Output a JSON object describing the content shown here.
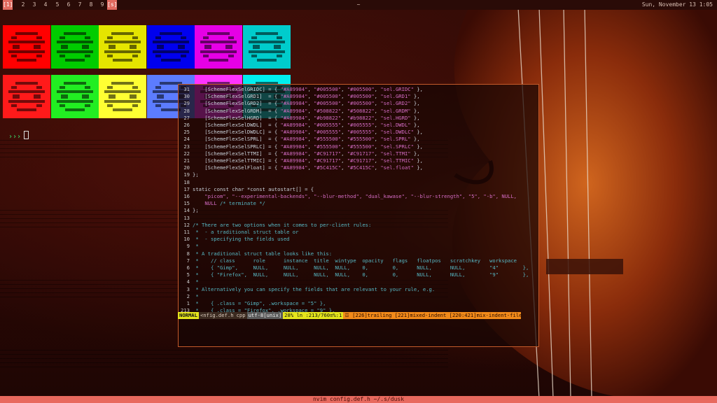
{
  "topbar": {
    "tags": [
      "[1]",
      "2",
      "3",
      "4",
      "5",
      "6",
      "7",
      "8",
      "9",
      "[s]"
    ],
    "active_tag": 0,
    "window_title": "~",
    "clock": "Sun, November 13 1:05"
  },
  "palette": {
    "row1": [
      "#ff0000",
      "#00cc00",
      "#e5e500",
      "#0000ee",
      "#e600e6",
      "#00cccc"
    ],
    "row2": [
      "#ff1a1a",
      "#22ee22",
      "#ffff33",
      "#5c7cff",
      "#ff33ff",
      "#00eeee"
    ],
    "icon": "space-invader-icon"
  },
  "terminal": {
    "prompt_symbol": "›››",
    "cursor": ""
  },
  "editor": {
    "lines": [
      {
        "num": "31",
        "text": "    [SchemeFlexSelGRIDC] = { \"#A89984\", \"#005500\", \"#005500\", \"sel.GRIDC\" },",
        "cls": "mix"
      },
      {
        "num": "30",
        "text": "    [SchemeFlexSelGRD1]  = { \"#A89984\", \"#005500\", \"#005500\", \"sel.GRD1\" },",
        "cls": "mix"
      },
      {
        "num": "29",
        "text": "    [SchemeFlexSelGRD2]  = { \"#A89984\", \"#005500\", \"#005500\", \"sel.GRD2\" },",
        "cls": "mix"
      },
      {
        "num": "28",
        "text": "    [SchemeFlexSelGRDM]  = { \"#A89984\", \"#508822\", \"#508822\", \"sel.GRDM\" },",
        "cls": "mix"
      },
      {
        "num": "27",
        "text": "    [SchemeFlexSelHGRD]  = { \"#A89984\", \"#b98822\", \"#b98822\", \"sel.HGRD\" },",
        "cls": "mix"
      },
      {
        "num": "26",
        "text": "    [SchemeFlexSelDWDL]  = { \"#A89984\", \"#005555\", \"#005555\", \"sel.DWDL\" },",
        "cls": "mix"
      },
      {
        "num": "25",
        "text": "    [SchemeFlexSelDWDLC] = { \"#A89984\", \"#005555\", \"#005555\", \"sel.DWDLC\" },",
        "cls": "mix"
      },
      {
        "num": "24",
        "text": "    [SchemeFlexSelSPRL]  = { \"#A89984\", \"#555500\", \"#555500\", \"sel.SPRL\" },",
        "cls": "mix"
      },
      {
        "num": "23",
        "text": "    [SchemeFlexSelSPRLC] = { \"#A89984\", \"#555500\", \"#555500\", \"sel.SPRLC\" },",
        "cls": "mix"
      },
      {
        "num": "22",
        "text": "    [SchemeFlexSelTTMI]  = { \"#A89984\", \"#C91717\", \"#C91717\", \"sel.TTMI\" },",
        "cls": "mix"
      },
      {
        "num": "21",
        "text": "    [SchemeFlexSelTTMIC] = { \"#A89984\", \"#C91717\", \"#C91717\", \"sel.TTMIC\" },",
        "cls": "mix"
      },
      {
        "num": "20",
        "text": "    [SchemeFlexSelFloat] = { \"#A89984\", \"#5C415C\", \"#5C415C\", \"sel.float\" },",
        "cls": "mix"
      },
      {
        "num": "19",
        "text": "};",
        "cls": "plain"
      },
      {
        "num": "18",
        "text": "",
        "cls": "plain"
      },
      {
        "num": "17",
        "text": "static const char *const autostart[] = {",
        "cls": "plain"
      },
      {
        "num": "16",
        "text": "    \"picom\", \"--experimental-backends\", \"--blur-method\", \"dual_kawase\", \"--blur-strength\", \"5\", \"-b\", NULL,",
        "cls": "str"
      },
      {
        "num": "15",
        "text": "    NULL /* terminate */",
        "cls": "mix2"
      },
      {
        "num": "14",
        "text": "};",
        "cls": "plain"
      },
      {
        "num": "13",
        "text": "",
        "cls": "plain"
      },
      {
        "num": "12",
        "text": "/* There are two options when it comes to per-client rules:",
        "cls": "cmt"
      },
      {
        "num": "11",
        "text": " *  - a traditional struct table or",
        "cls": "cmt"
      },
      {
        "num": "10",
        "text": " *  - specifying the fields used",
        "cls": "cmt"
      },
      {
        "num": "9",
        "text": " *",
        "cls": "cmt"
      },
      {
        "num": "8",
        "text": " * A traditional struct table looks like this:",
        "cls": "cmt"
      },
      {
        "num": "7",
        "text": " *    // class      role      instance  title  wintype  opacity   flags   floatpos   scratchkey   workspace",
        "cls": "cmt"
      },
      {
        "num": "6",
        "text": " *    { \"Gimp\",     NULL,     NULL,     NULL,  NULL,    0,        0,      NULL,      NULL,        \"4\"        },",
        "cls": "cmt"
      },
      {
        "num": "5",
        "text": " *    { \"Firefox\",  NULL,     NULL,     NULL,  NULL,    0,        0,      NULL,      NULL,        \"9\"        },",
        "cls": "cmt"
      },
      {
        "num": "4",
        "text": " *",
        "cls": "cmt"
      },
      {
        "num": "3",
        "text": " * Alternatively you can specify the fields that are relevant to your rule, e.g.",
        "cls": "cmt"
      },
      {
        "num": "2",
        "text": " *",
        "cls": "cmt"
      },
      {
        "num": "1",
        "text": " *    { .class = \"Gimp\", .workspace = \"5\" },",
        "cls": "cmt"
      },
      {
        "num": "213",
        "text": " *    { .class = \"Firefox\", .workspace = \"9\" },",
        "cls": "cmt"
      }
    ],
    "status": {
      "mode": "NORMAL",
      "file": "<nfig.def.h",
      "filetype": "cpp",
      "encoding": "utf-8[unix]",
      "position": "28% ln :213/760≡%:1",
      "warnings": "☲ [226]trailing [221]mixed-indent [220:421]mix-indent-file"
    }
  },
  "bottombar": {
    "title": "nvim config.def.h ~/.s/dusk"
  },
  "colors": {
    "accent": "#e06a5f",
    "comment": "#56b6c2",
    "string": "#d46cc4",
    "status_mode": "#e5e51c",
    "status_warn": "#f28a1a"
  }
}
